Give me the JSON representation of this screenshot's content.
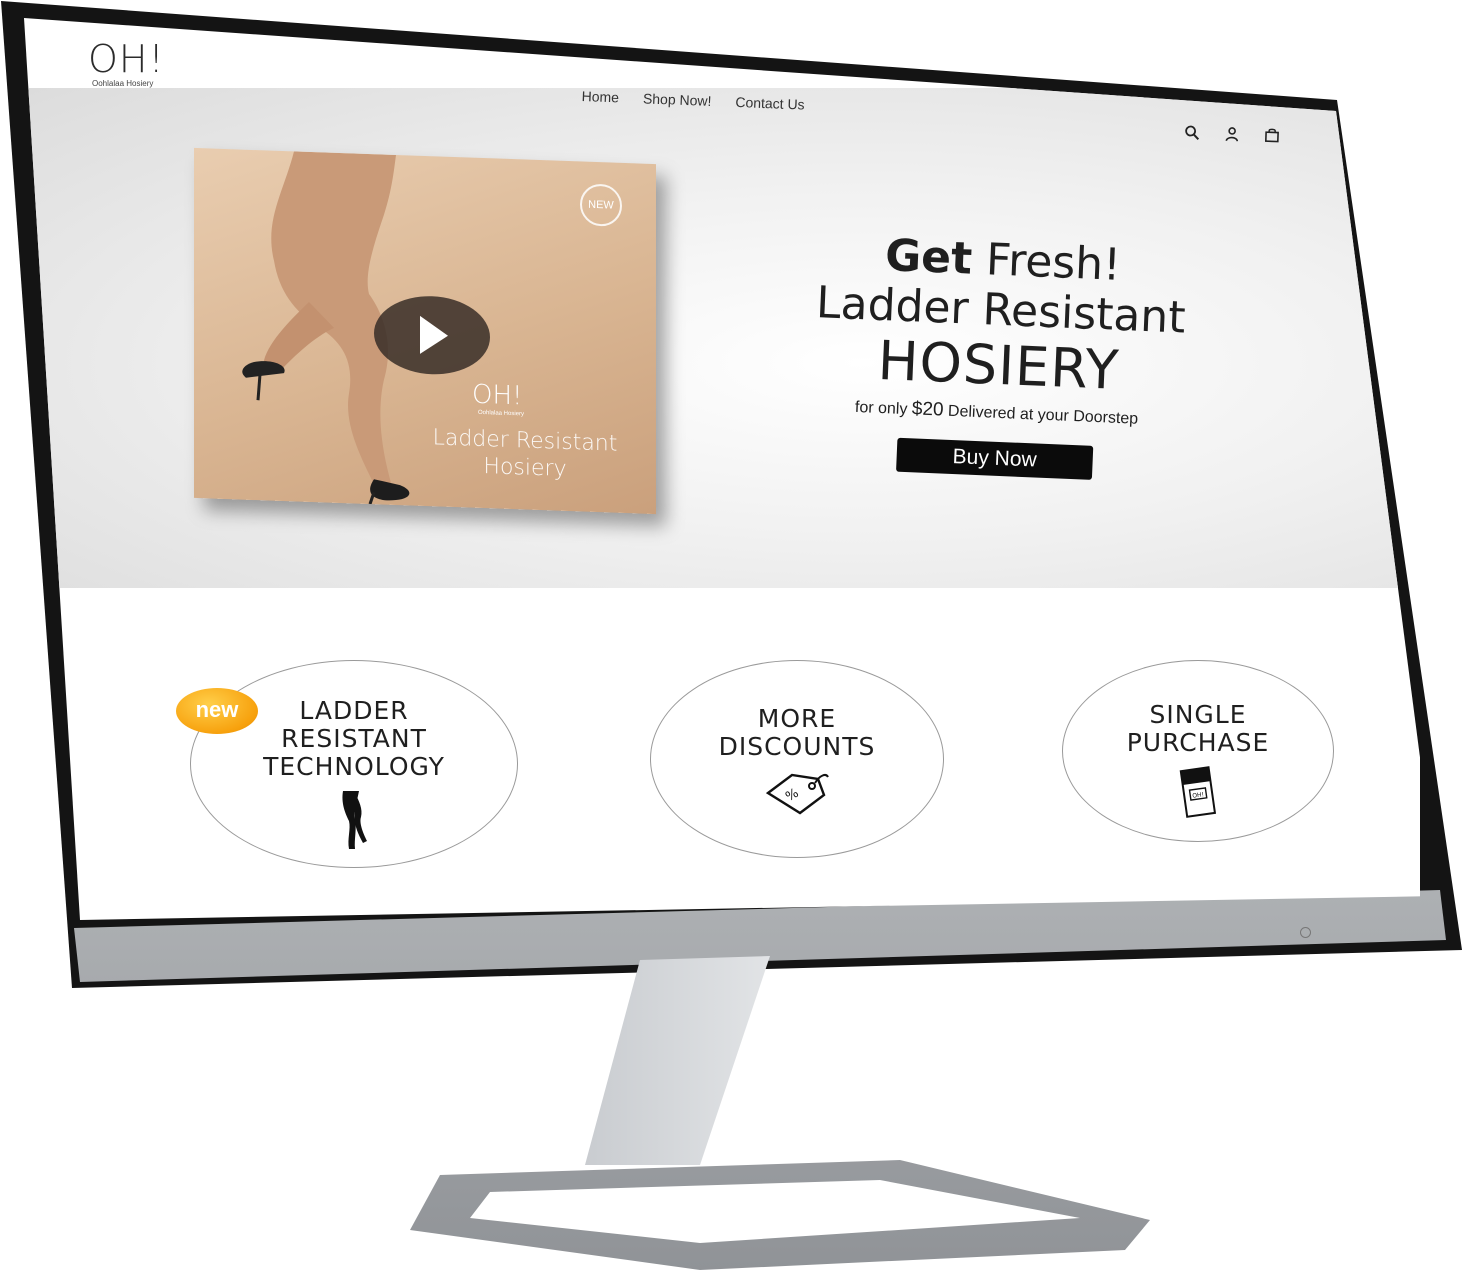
{
  "site": {
    "logo_mark": "OH!",
    "logo_sub": "Oohlalaa Hosiery"
  },
  "nav": {
    "items": [
      "Home",
      "Shop Now!",
      "Contact Us"
    ]
  },
  "header_icons": [
    "search-icon",
    "account-icon",
    "cart-icon"
  ],
  "hero": {
    "poster": {
      "badge": "NEW",
      "logo_mark": "OH!",
      "logo_sub": "Oohlalaa Hosiery",
      "title_line1": "Ladder Resistant",
      "title_line2": "Hosiery"
    },
    "headline_bold": "Get",
    "headline_rest": "Fresh!",
    "headline_line2": "Ladder Resistant",
    "headline_line3": "HOSIERY",
    "sub_prefix": "for only",
    "sub_price": "$20",
    "sub_suffix": "Delivered at your Doorstep",
    "cta": "Buy Now"
  },
  "features": [
    {
      "badge": "new",
      "line1": "LADDER",
      "line2": "RESISTANT",
      "line3": "TECHNOLOGY",
      "icon": "legs-icon"
    },
    {
      "line1": "MORE",
      "line2": "DISCOUNTS",
      "icon": "discount-tag-icon"
    },
    {
      "line1": "SINGLE",
      "line2": "PURCHASE",
      "icon": "product-pack-icon"
    }
  ],
  "colors": {
    "accent_badge": "#f7a10d",
    "cta_bg": "#0b0b0b",
    "poster_tone": "#d9b592"
  }
}
